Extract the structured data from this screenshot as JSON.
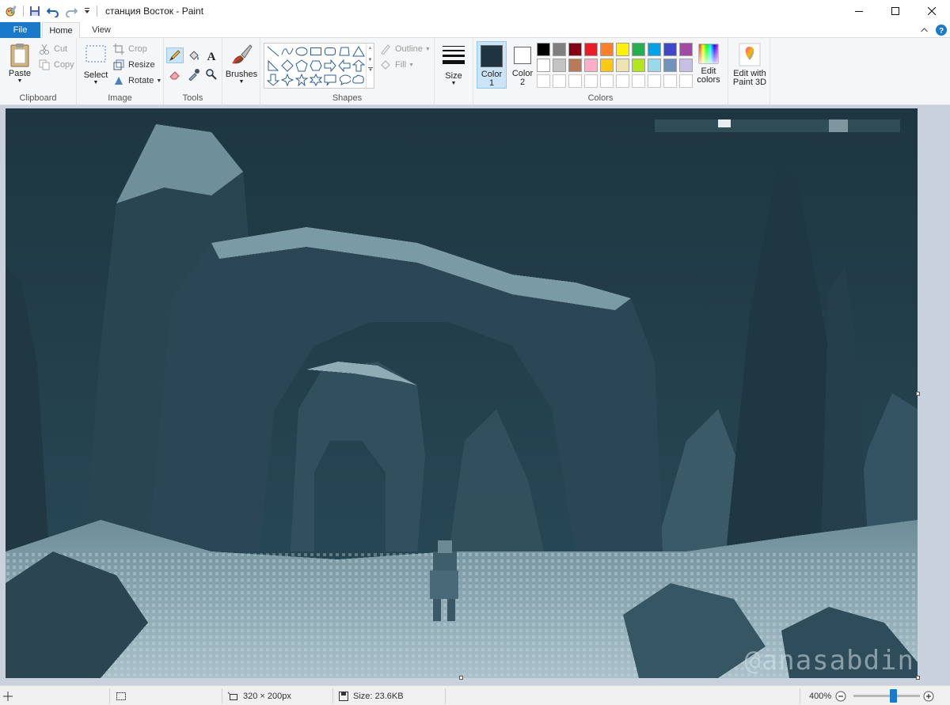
{
  "window": {
    "title": "станция Восток - Paint"
  },
  "tabs": {
    "file": "File",
    "home": "Home",
    "view": "View"
  },
  "ribbon": {
    "clipboard": {
      "label": "Clipboard",
      "paste": "Paste",
      "cut": "Cut",
      "copy": "Copy"
    },
    "image": {
      "label": "Image",
      "select": "Select",
      "crop": "Crop",
      "resize": "Resize",
      "rotate": "Rotate"
    },
    "tools": {
      "label": "Tools"
    },
    "brushes": {
      "label": "Brushes"
    },
    "shapes": {
      "label": "Shapes",
      "outline": "Outline",
      "fill": "Fill"
    },
    "size": {
      "label": "Size"
    },
    "colors": {
      "label": "Colors",
      "color1_line1": "Color",
      "color1_line2": "1",
      "color2_line1": "Color",
      "color2_line2": "2",
      "color1_value": "#1e3440",
      "color2_value": "#ffffff",
      "edit_line1": "Edit",
      "edit_line2": "colors",
      "palette_row1": [
        "#000000",
        "#7f7f7f",
        "#880015",
        "#ed1c24",
        "#ff7f27",
        "#fff200",
        "#22b14c",
        "#00a2e8",
        "#3f48cc",
        "#a349a4"
      ],
      "palette_row2": [
        "#ffffff",
        "#c3c3c3",
        "#b97a57",
        "#ffaec9",
        "#ffc90e",
        "#efe4b0",
        "#b5e61d",
        "#99d9ea",
        "#7092be",
        "#c8bfe7"
      ],
      "palette_row3": [
        "#ffffff",
        "#ffffff",
        "#ffffff",
        "#ffffff",
        "#ffffff",
        "#ffffff",
        "#ffffff",
        "#ffffff",
        "#ffffff",
        "#ffffff"
      ]
    },
    "paint3d": {
      "line1": "Edit with",
      "line2": "Paint 3D"
    }
  },
  "canvas": {
    "watermark": "@anasabdin"
  },
  "status": {
    "dimensions": "320 × 200px",
    "size": "Size: 23.6KB",
    "zoom": "400%"
  }
}
